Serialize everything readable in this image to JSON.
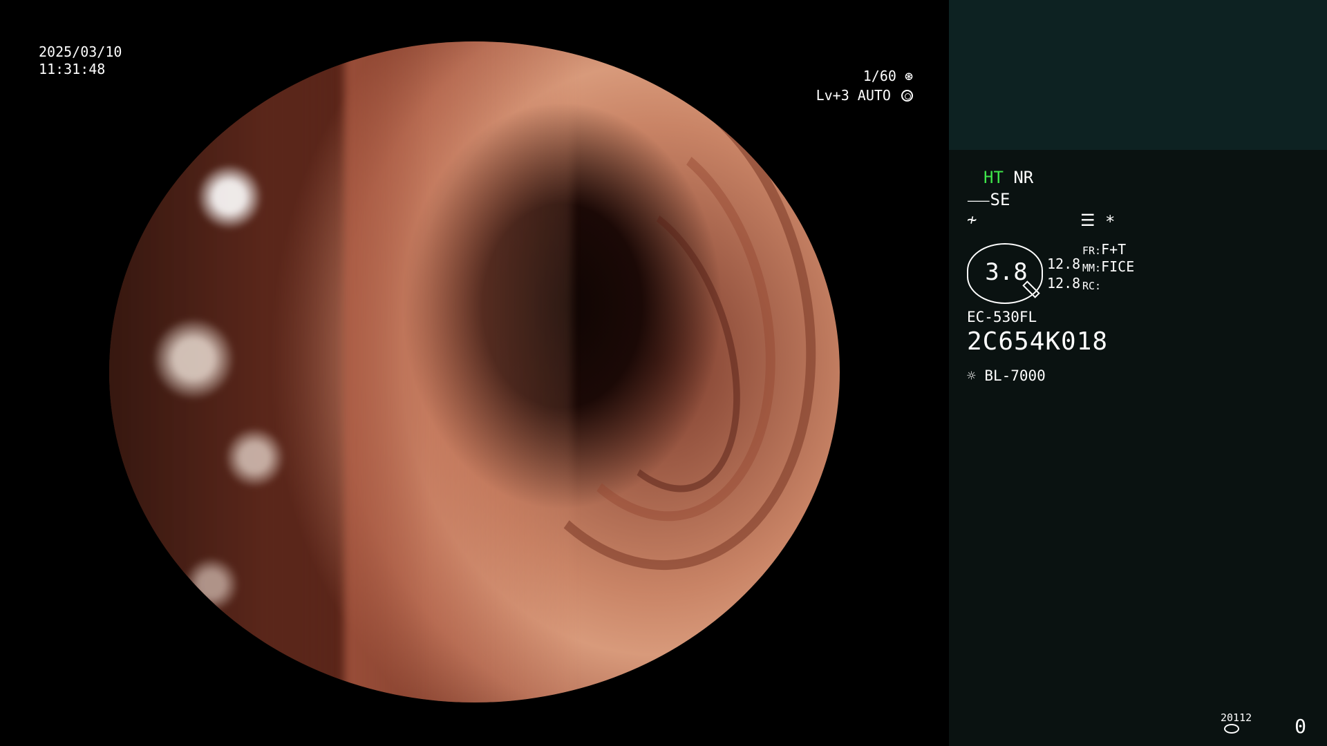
{
  "video": {
    "date": "2025/03/10",
    "time": "11:31:48",
    "shutter": "1/60",
    "shutter_icon": "aperture-icon",
    "level": "Lv+3 AUTO",
    "level_icon": "auto-exposure-icon"
  },
  "panel": {
    "ht_label": "HT",
    "nr_label": "NR",
    "se_label": "SE",
    "se_icon": "structure-enhance-icon",
    "slash_icon": "filter-off-icon",
    "memo_icon": "list-icon",
    "star": "*",
    "gauge_value": "3.8",
    "value_left_1": "12.8",
    "value_left_2": "12.8",
    "fr_label": "FR:",
    "fr_value": "F+T",
    "mm_label": "MM:",
    "mm_value": "FICE",
    "rc_label": "RC:",
    "rc_value": "",
    "scope_model": "EC-530FL",
    "scope_serial": "2C654K018",
    "light_source_icon": "light-bulb-icon",
    "light_source": "BL-7000",
    "storage_id": "20112",
    "storage_icon": "disk-icon",
    "counter": "0"
  },
  "colors": {
    "panel_bg": "#0a1211",
    "panel_top": "#0d2222",
    "ht_green": "#3fe64a"
  }
}
